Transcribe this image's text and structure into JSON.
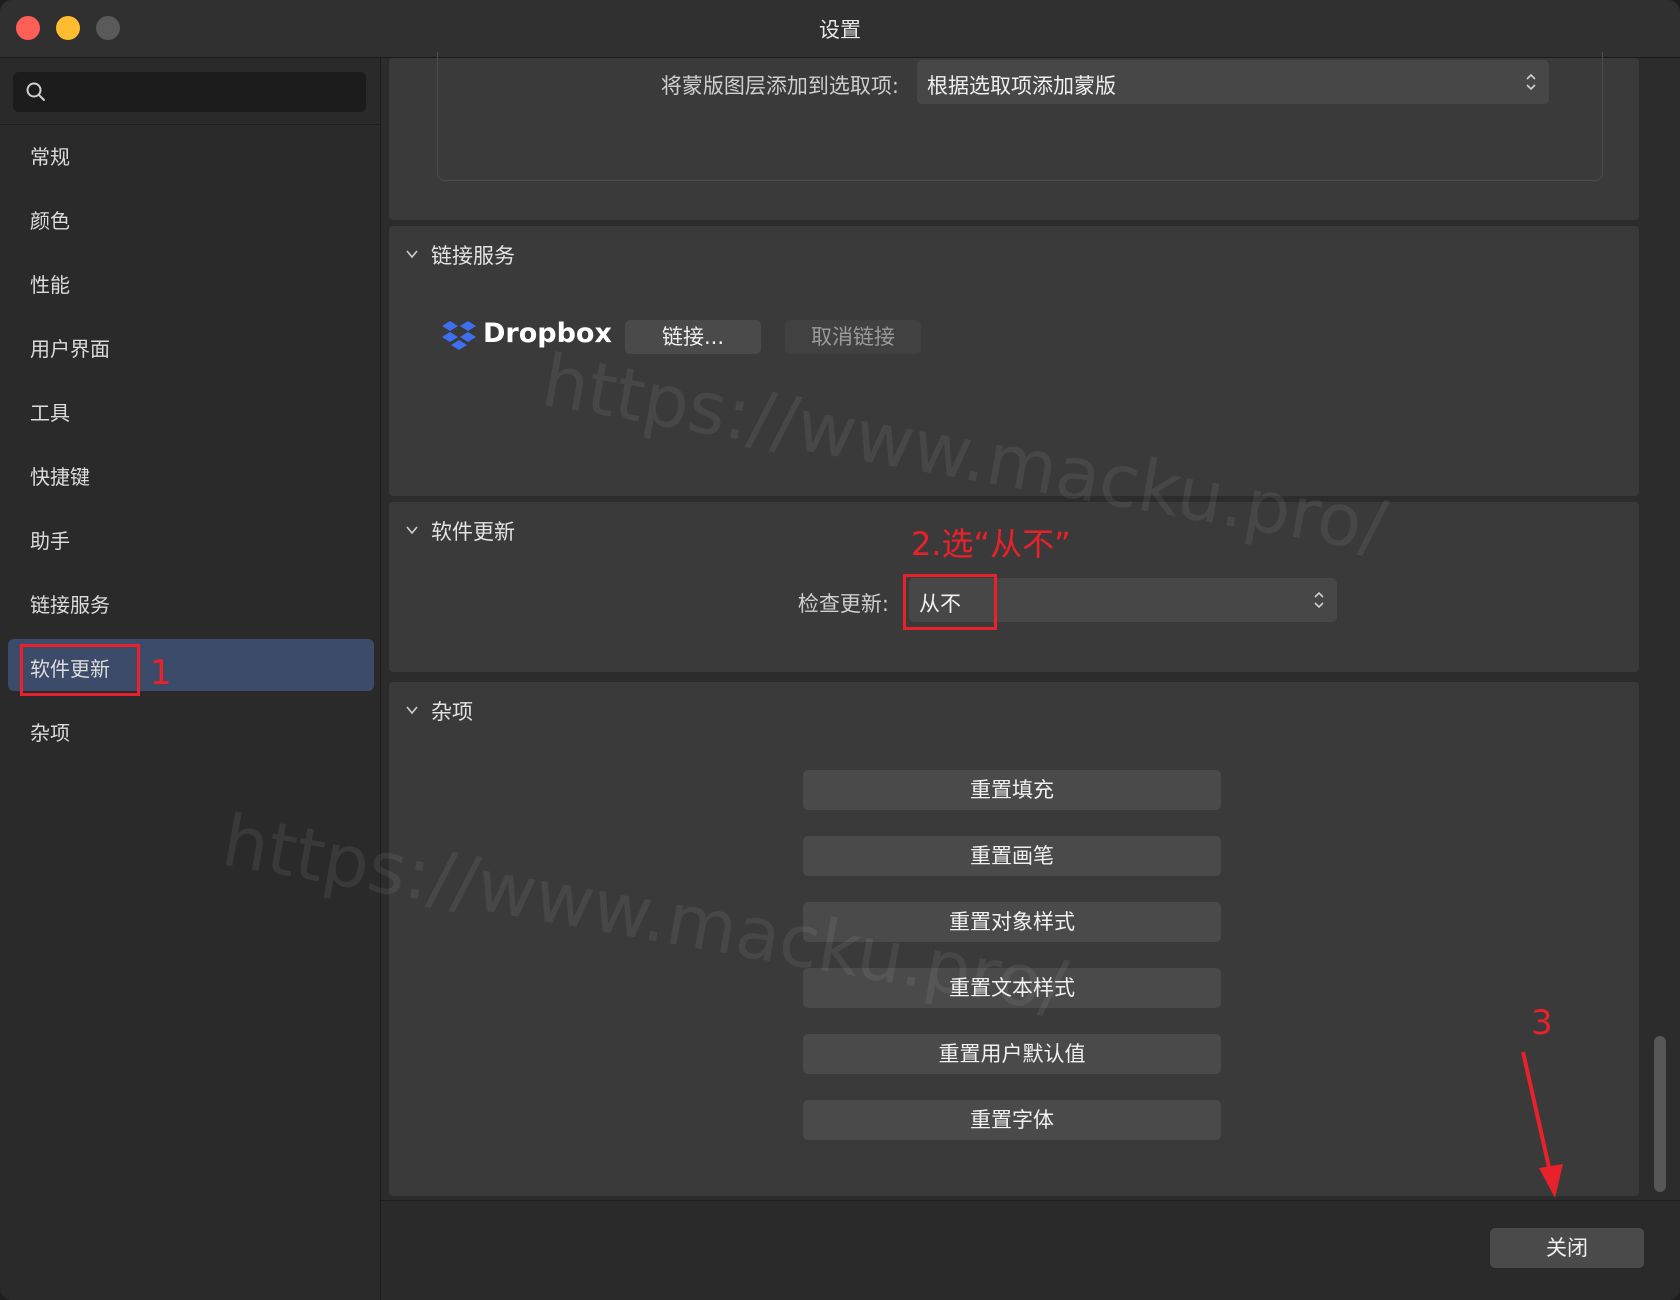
{
  "window": {
    "title": "设置"
  },
  "search": {
    "placeholder": ""
  },
  "sidebar": {
    "items": [
      {
        "label": "常规"
      },
      {
        "label": "颜色"
      },
      {
        "label": "性能"
      },
      {
        "label": "用户界面"
      },
      {
        "label": "工具"
      },
      {
        "label": "快捷键"
      },
      {
        "label": "助手"
      },
      {
        "label": "链接服务"
      },
      {
        "label": "软件更新",
        "selected": true
      },
      {
        "label": "杂项"
      }
    ]
  },
  "mask_section": {
    "label": "将蒙版图层添加到选取项:",
    "value": "根据选取项添加蒙版"
  },
  "link_services": {
    "header": "链接服务",
    "provider": "Dropbox",
    "link_button": "链接...",
    "unlink_button": "取消链接"
  },
  "software_update": {
    "header": "软件更新",
    "check_label": "检查更新:",
    "check_value": "从不"
  },
  "misc": {
    "header": "杂项",
    "buttons": [
      "重置填充",
      "重置画笔",
      "重置对象样式",
      "重置文本样式",
      "重置用户默认值",
      "重置字体"
    ]
  },
  "footer": {
    "close_label": "关闭"
  },
  "annotations": {
    "step1": "1",
    "step2": "2.选“从不”",
    "step3": "3",
    "color": "#e8212a"
  },
  "watermark": "https://www.macku.pro/",
  "colors": {
    "selected_bg": "#3d4b6a",
    "dropbox_blue": "#3d6ff0"
  }
}
